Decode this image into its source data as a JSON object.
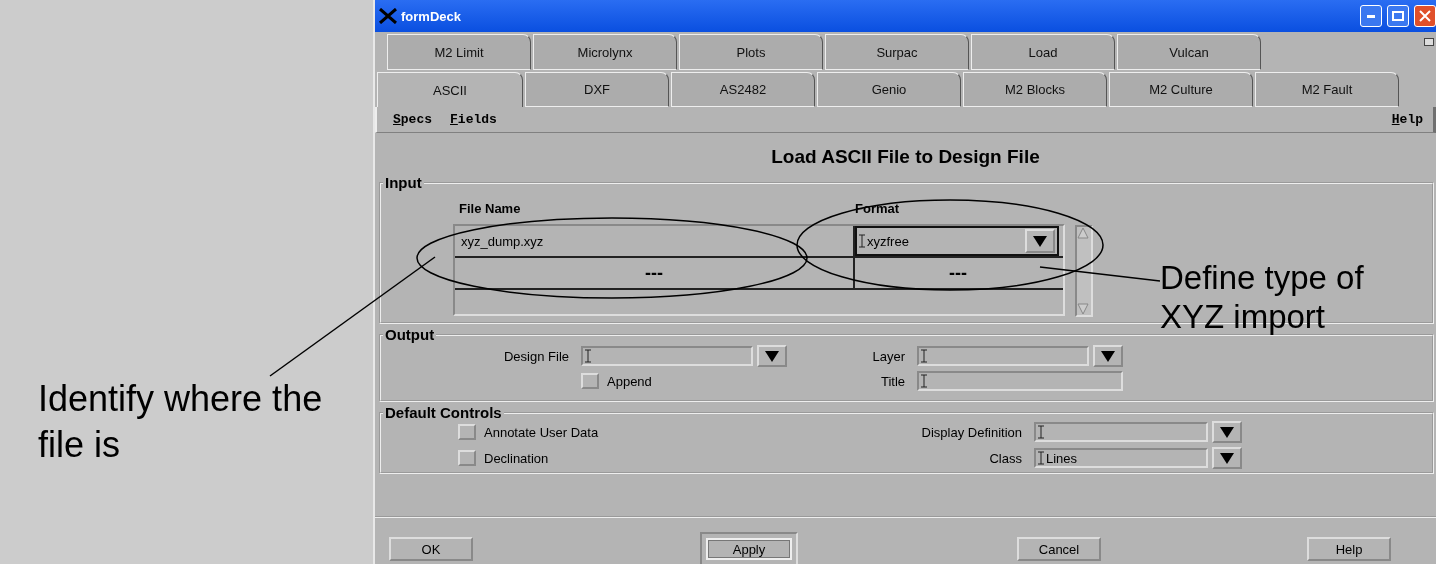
{
  "window": {
    "title": "formDeck"
  },
  "tabs_row_1": [
    {
      "label": "M2 Limit",
      "selected": false
    },
    {
      "label": "Microlynx",
      "selected": false
    },
    {
      "label": "Plots",
      "selected": false
    },
    {
      "label": "Surpac",
      "selected": false
    },
    {
      "label": "Load",
      "selected": false
    },
    {
      "label": "Vulcan",
      "selected": false
    }
  ],
  "tabs_row_2": [
    {
      "label": "ASCII",
      "selected": true
    },
    {
      "label": "DXF",
      "selected": false
    },
    {
      "label": "AS2482",
      "selected": false
    },
    {
      "label": "Genio",
      "selected": false
    },
    {
      "label": "M2 Blocks",
      "selected": false
    },
    {
      "label": "M2 Culture",
      "selected": false
    },
    {
      "label": "M2 Fault",
      "selected": false
    }
  ],
  "menu": {
    "left": [
      "Specs",
      "Fields"
    ],
    "right": [
      "Help"
    ]
  },
  "heading": "Load ASCII File to Design File",
  "input": {
    "label": "Input",
    "columns": [
      "File Name",
      "Format"
    ],
    "rows": [
      {
        "kind": "value",
        "file_name": "xyz_dump.xyz",
        "format": "xyzfree"
      },
      {
        "kind": "more",
        "file_name": "---",
        "format": "---"
      }
    ]
  },
  "output": {
    "label": "Output",
    "design_file": {
      "label": "Design File"
    },
    "append": {
      "label": "Append",
      "checked": false
    },
    "layer": {
      "label": "Layer"
    },
    "title": {
      "label": "Title"
    }
  },
  "default_controls": {
    "label": "Default Controls",
    "checkboxes": [
      {
        "label": "Annotate User Data",
        "checked": false
      },
      {
        "label": "Declination",
        "checked": false
      }
    ],
    "display_definition": {
      "label": "Display Definition"
    },
    "class": {
      "label": "Class",
      "value": "Lines"
    }
  },
  "buttons": [
    {
      "label": "OK",
      "default": false
    },
    {
      "label": "Apply",
      "default": true
    },
    {
      "label": "Cancel",
      "default": false
    },
    {
      "label": "Help",
      "default": false
    }
  ],
  "annotations": [
    {
      "text": "Identify where the file is"
    },
    {
      "text": "Define type of XYZ import"
    }
  ]
}
